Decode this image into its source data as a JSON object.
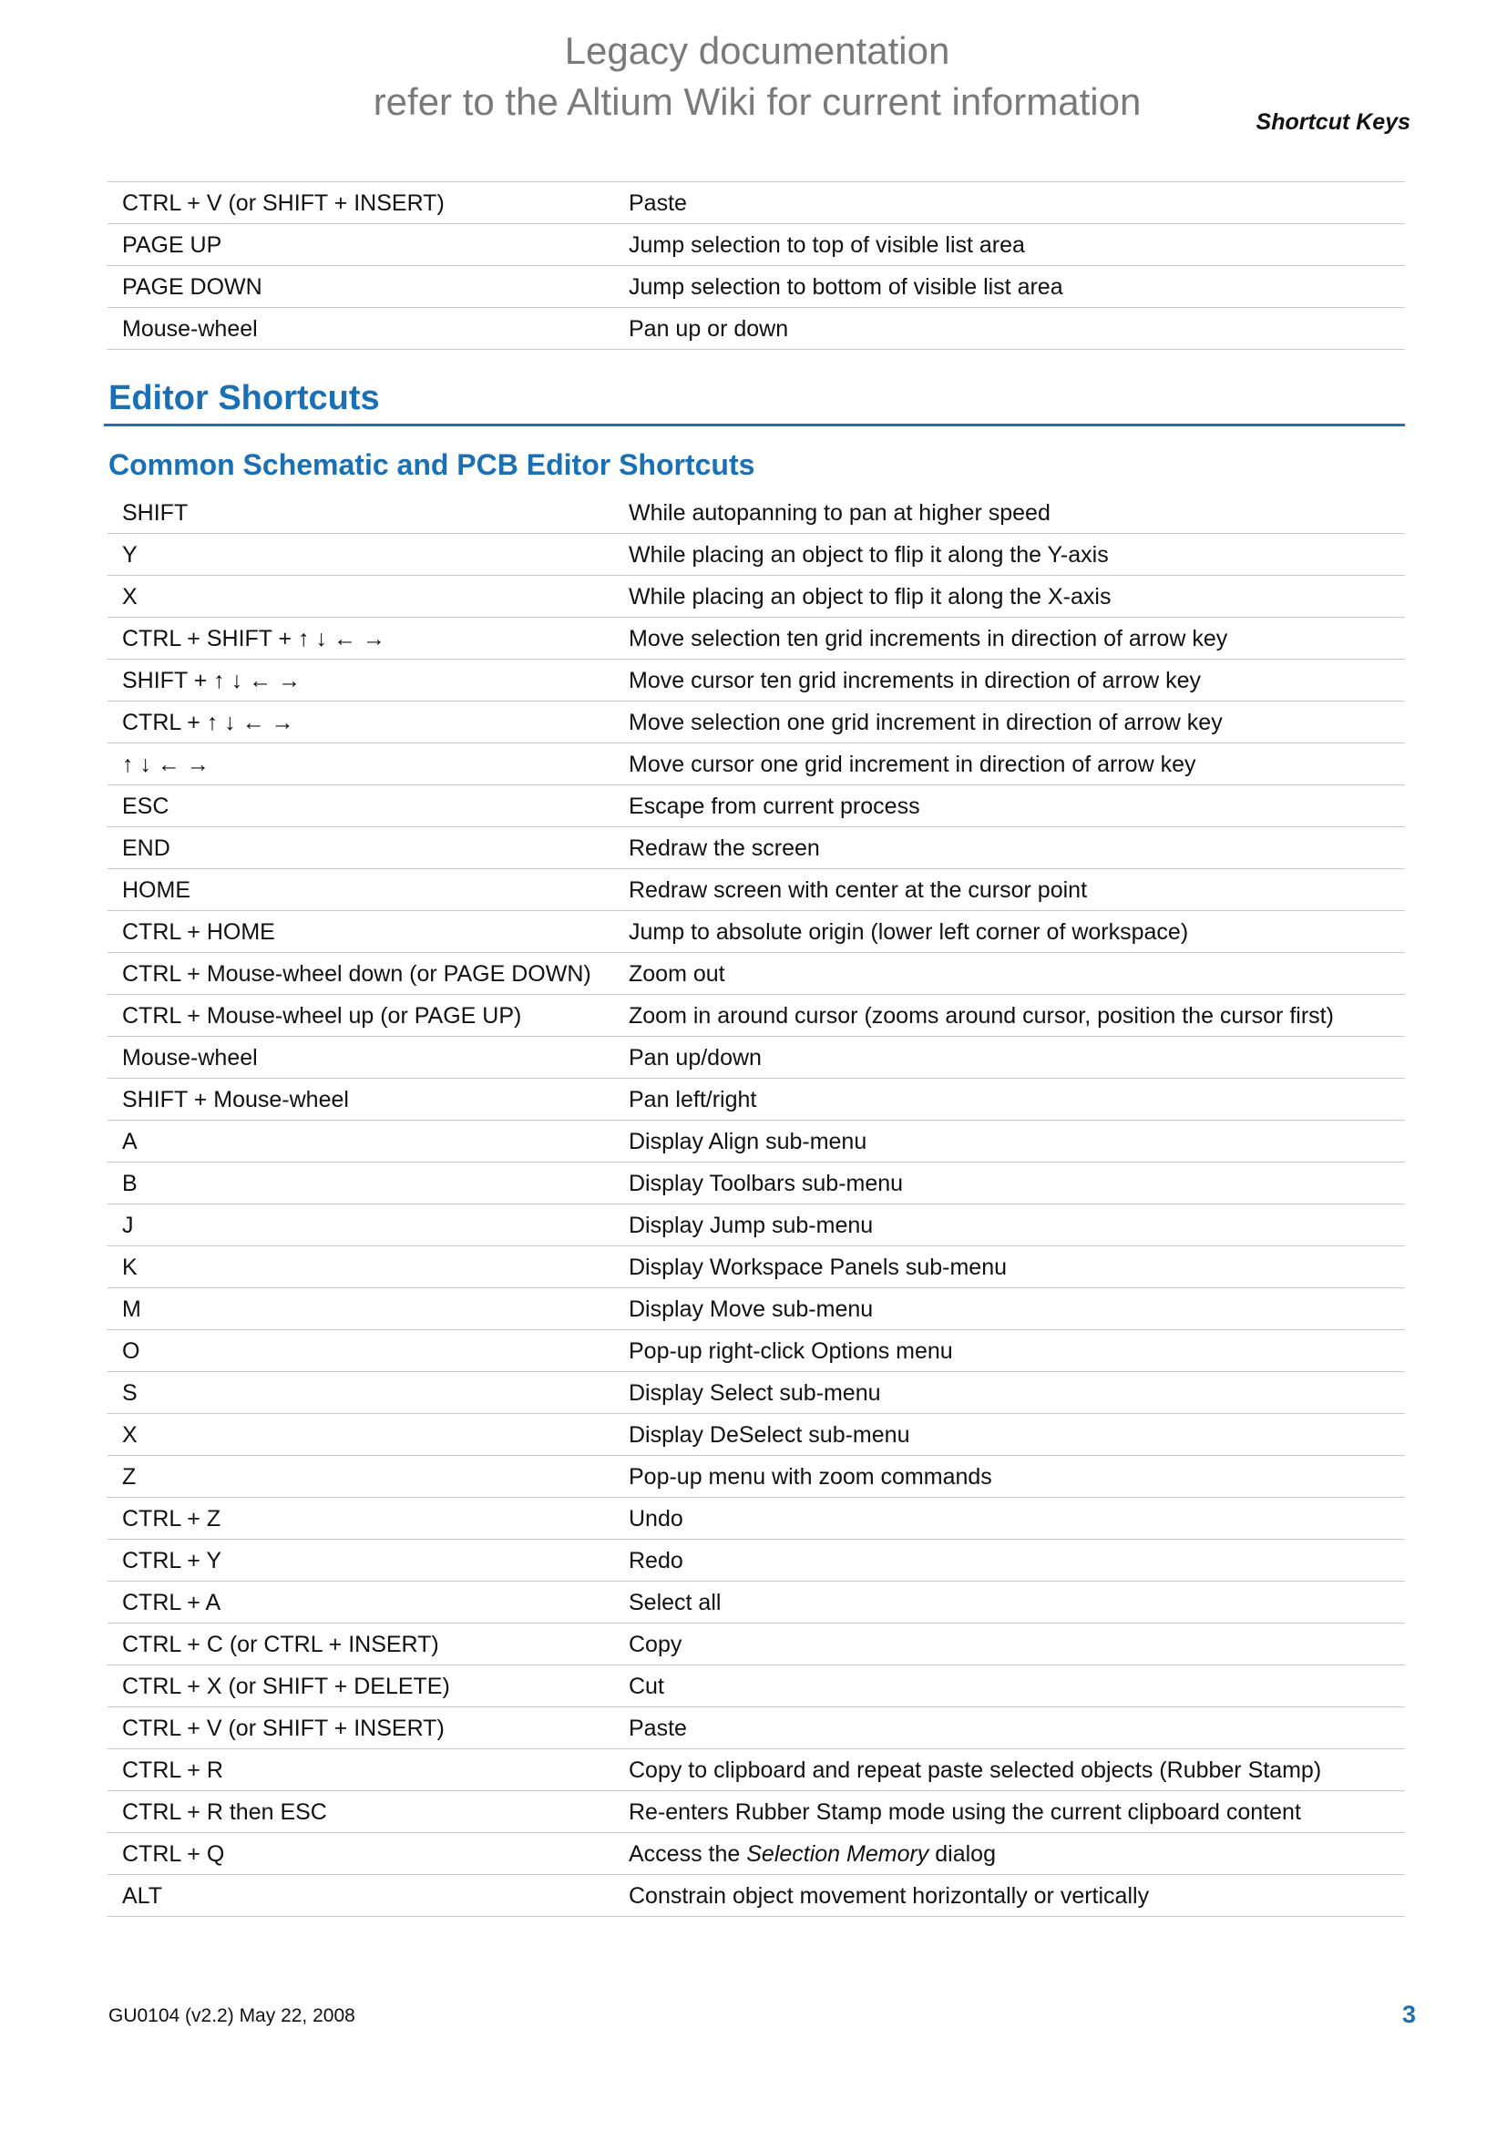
{
  "header": {
    "legacy_line1": "Legacy documentation",
    "legacy_line2": "refer to the Altium Wiki for current information",
    "section_title": "Shortcut Keys"
  },
  "list_shortcuts": [
    {
      "key": "CTRL + V (or SHIFT + INSERT)",
      "desc": "Paste"
    },
    {
      "key": "PAGE UP",
      "desc": "Jump selection to top of visible list area"
    },
    {
      "key": "PAGE DOWN",
      "desc": "Jump selection to bottom of visible list area"
    },
    {
      "key": "Mouse-wheel",
      "desc": "Pan up or down"
    }
  ],
  "editor_heading": "Editor Shortcuts",
  "common_heading": "Common Schematic and PCB Editor Shortcuts",
  "editor_shortcuts": [
    {
      "key": "SHIFT",
      "desc": "While autopanning to pan at higher speed"
    },
    {
      "key": "Y",
      "desc": "While placing an object to flip it along the Y-axis"
    },
    {
      "key": "X",
      "desc": "While placing an object to flip it along the X-axis"
    },
    {
      "key": "CTRL + SHIFT + ↑ ↓ ← →",
      "desc": "Move selection ten grid increments in direction of arrow key"
    },
    {
      "key": "SHIFT + ↑ ↓ ← →",
      "desc": "Move cursor ten grid increments in direction of arrow key"
    },
    {
      "key": "CTRL + ↑ ↓ ← →",
      "desc": "Move selection one grid increment in direction of arrow key"
    },
    {
      "key": "↑ ↓ ← →",
      "desc": "Move cursor one grid increment in direction of arrow key"
    },
    {
      "key": "ESC",
      "desc": "Escape from current process"
    },
    {
      "key": "END",
      "desc": "Redraw the screen"
    },
    {
      "key": "HOME",
      "desc": "Redraw screen with center at the cursor point"
    },
    {
      "key": "CTRL + HOME",
      "desc": "Jump to absolute origin (lower left corner of workspace)"
    },
    {
      "key": "CTRL + Mouse-wheel down (or PAGE DOWN)",
      "desc": "Zoom out"
    },
    {
      "key": "CTRL + Mouse-wheel up (or PAGE UP)",
      "desc": "Zoom in around cursor (zooms around cursor, position the cursor first)"
    },
    {
      "key": "Mouse-wheel",
      "desc": "Pan up/down"
    },
    {
      "key": "SHIFT + Mouse-wheel",
      "desc": "Pan left/right"
    },
    {
      "key": "A",
      "desc": "Display Align sub-menu"
    },
    {
      "key": "B",
      "desc": "Display Toolbars sub-menu"
    },
    {
      "key": "J",
      "desc": "Display Jump sub-menu"
    },
    {
      "key": "K",
      "desc": "Display Workspace Panels sub-menu"
    },
    {
      "key": "M",
      "desc": "Display Move sub-menu"
    },
    {
      "key": "O",
      "desc": "Pop-up right-click Options menu"
    },
    {
      "key": "S",
      "desc": "Display Select sub-menu"
    },
    {
      "key": "X",
      "desc": "Display DeSelect sub-menu"
    },
    {
      "key": "Z",
      "desc": "Pop-up menu with zoom commands"
    },
    {
      "key": "CTRL + Z",
      "desc": "Undo"
    },
    {
      "key": "CTRL + Y",
      "desc": "Redo"
    },
    {
      "key": "CTRL + A",
      "desc": "Select all"
    },
    {
      "key": "CTRL + C (or CTRL + INSERT)",
      "desc": "Copy"
    },
    {
      "key": "CTRL + X (or SHIFT + DELETE)",
      "desc": "Cut"
    },
    {
      "key": "CTRL + V (or SHIFT + INSERT)",
      "desc": "Paste"
    },
    {
      "key": "CTRL + R",
      "desc": "Copy to clipboard and repeat paste selected objects (Rubber Stamp)"
    },
    {
      "key": "CTRL + R then ESC",
      "desc": "Re-enters Rubber Stamp mode using the current clipboard content"
    },
    {
      "key": "CTRL + Q",
      "desc_parts": [
        "Access the ",
        "Selection Memory",
        " dialog"
      ]
    },
    {
      "key": "ALT",
      "desc": "Constrain object movement horizontally or vertically"
    }
  ],
  "footer": {
    "doc_ref": "GU0104 (v2.2) May 22, 2008",
    "page_number": "3"
  }
}
